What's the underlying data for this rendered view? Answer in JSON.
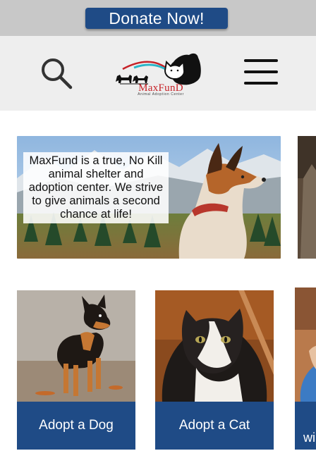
{
  "donate": {
    "label": "Donate Now!"
  },
  "header": {
    "logo_text": "MaxFunD",
    "logo_subtitle": "Animal Adoption Center"
  },
  "hero": {
    "text": "MaxFund is a true, No Kill animal shelter and adoption center. We strive to give animals a second chance at life!"
  },
  "cards": [
    {
      "label": "Adopt a Dog"
    },
    {
      "label": "Adopt a Cat"
    }
  ],
  "peek_card": {
    "label_fragment": "wi"
  },
  "colors": {
    "brand_blue": "#1f4b86",
    "logo_red": "#c62127",
    "header_bg": "#eeeeee",
    "donate_bar_bg": "#c8c8c8"
  },
  "icons": {
    "search": "search-icon",
    "menu": "hamburger-menu-icon"
  }
}
